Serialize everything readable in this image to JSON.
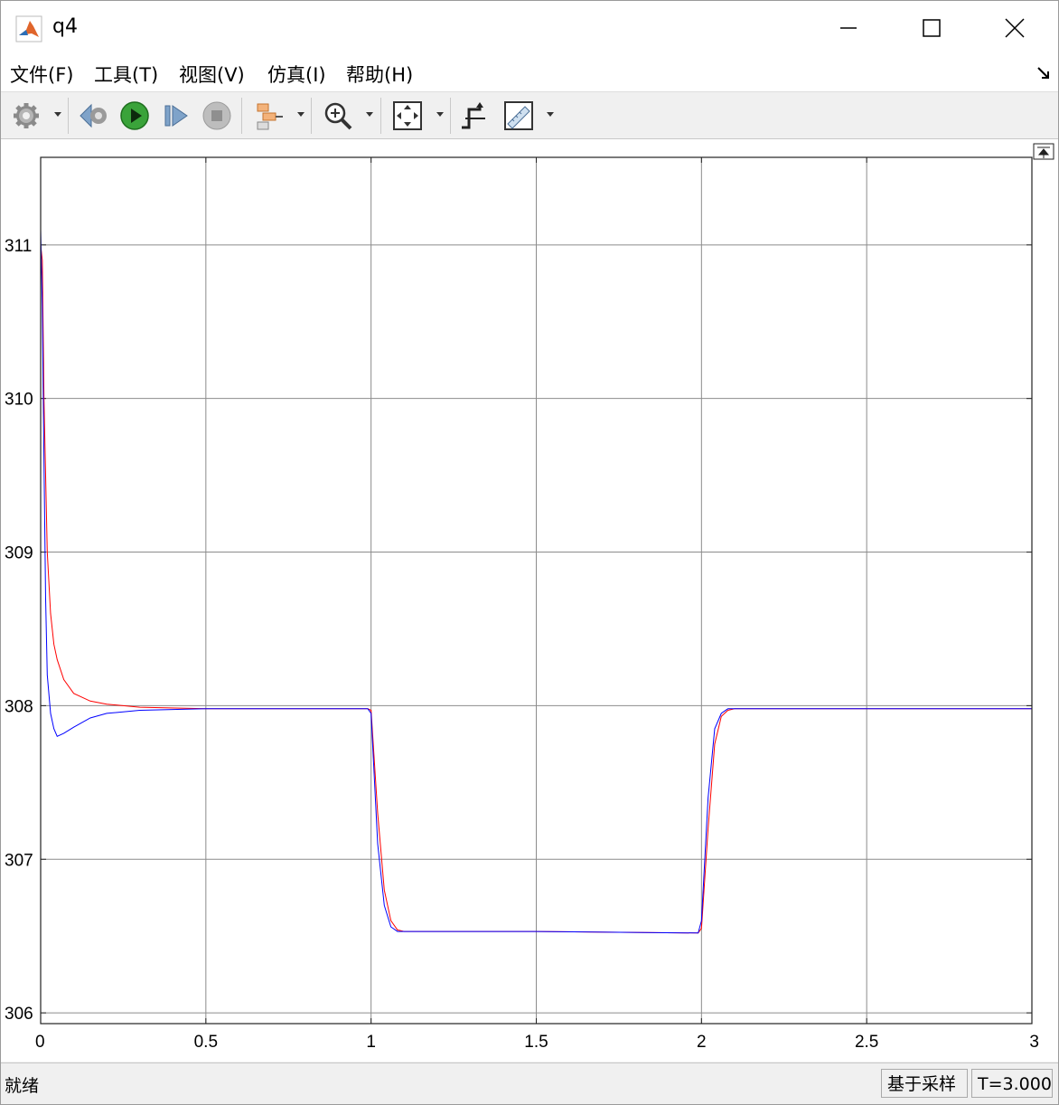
{
  "window": {
    "title": "q4",
    "minimize_label": "minimize",
    "maximize_label": "maximize",
    "close_label": "close"
  },
  "menu": {
    "items": [
      "文件(F)",
      "工具(T)",
      "视图(V)",
      "仿真(I)",
      "帮助(H)"
    ]
  },
  "toolbar": {
    "icons": [
      "gear-icon",
      "step-back-icon",
      "run-icon",
      "step-forward-icon",
      "stop-icon",
      "signal-select-icon",
      "zoom-in-icon",
      "fit-view-icon",
      "trigger-icon",
      "measure-icon"
    ]
  },
  "status": {
    "left_text": "就绪",
    "mode": "基于采样",
    "time": "T=3.000"
  },
  "colors": {
    "series_red": "#ff0000",
    "series_blue": "#0000ff",
    "grid": "#8c8c8c"
  },
  "chart_data": {
    "type": "line",
    "title": "",
    "xlabel": "",
    "ylabel": "",
    "xlim": [
      0,
      3
    ],
    "ylim": [
      305.93,
      311.57
    ],
    "xticks": [
      "0",
      "0.5",
      "1",
      "1.5",
      "2",
      "2.5",
      "3"
    ],
    "yticks": [
      "306",
      "307",
      "308",
      "309",
      "310",
      "311"
    ],
    "xtick_values": [
      0,
      0.5,
      1,
      1.5,
      2,
      2.5,
      3
    ],
    "ytick_values": [
      306,
      307,
      308,
      309,
      310,
      311
    ],
    "grid": true,
    "series": [
      {
        "color": "#ff0000",
        "points": [
          [
            0,
            311.0
          ],
          [
            0.005,
            310.9
          ],
          [
            0.01,
            310.0
          ],
          [
            0.015,
            309.5
          ],
          [
            0.02,
            309.0
          ],
          [
            0.03,
            308.6
          ],
          [
            0.04,
            308.4
          ],
          [
            0.05,
            308.3
          ],
          [
            0.07,
            308.17
          ],
          [
            0.1,
            308.08
          ],
          [
            0.15,
            308.03
          ],
          [
            0.2,
            308.01
          ],
          [
            0.3,
            307.99
          ],
          [
            0.5,
            307.98
          ],
          [
            0.99,
            307.98
          ],
          [
            1.0,
            307.97
          ],
          [
            1.02,
            307.3
          ],
          [
            1.04,
            306.8
          ],
          [
            1.06,
            306.6
          ],
          [
            1.08,
            306.54
          ],
          [
            1.1,
            306.53
          ],
          [
            1.5,
            306.53
          ],
          [
            1.99,
            306.52
          ],
          [
            2.0,
            306.55
          ],
          [
            2.02,
            307.2
          ],
          [
            2.04,
            307.75
          ],
          [
            2.06,
            307.93
          ],
          [
            2.08,
            307.97
          ],
          [
            2.1,
            307.98
          ],
          [
            2.5,
            307.98
          ],
          [
            3.0,
            307.98
          ]
        ]
      },
      {
        "color": "#0000ff",
        "points": [
          [
            0,
            311.1
          ],
          [
            0.005,
            310.6
          ],
          [
            0.01,
            309.6
          ],
          [
            0.015,
            308.7
          ],
          [
            0.02,
            308.2
          ],
          [
            0.03,
            307.95
          ],
          [
            0.04,
            307.85
          ],
          [
            0.05,
            307.8
          ],
          [
            0.07,
            307.82
          ],
          [
            0.1,
            307.86
          ],
          [
            0.15,
            307.92
          ],
          [
            0.2,
            307.95
          ],
          [
            0.3,
            307.97
          ],
          [
            0.5,
            307.98
          ],
          [
            0.99,
            307.98
          ],
          [
            1.0,
            307.95
          ],
          [
            1.02,
            307.1
          ],
          [
            1.04,
            306.7
          ],
          [
            1.06,
            306.56
          ],
          [
            1.08,
            306.53
          ],
          [
            1.1,
            306.53
          ],
          [
            1.5,
            306.53
          ],
          [
            1.99,
            306.52
          ],
          [
            2.0,
            306.6
          ],
          [
            2.02,
            307.4
          ],
          [
            2.04,
            307.85
          ],
          [
            2.06,
            307.95
          ],
          [
            2.08,
            307.98
          ],
          [
            2.1,
            307.98
          ],
          [
            2.5,
            307.98
          ],
          [
            3.0,
            307.98
          ]
        ]
      }
    ]
  }
}
